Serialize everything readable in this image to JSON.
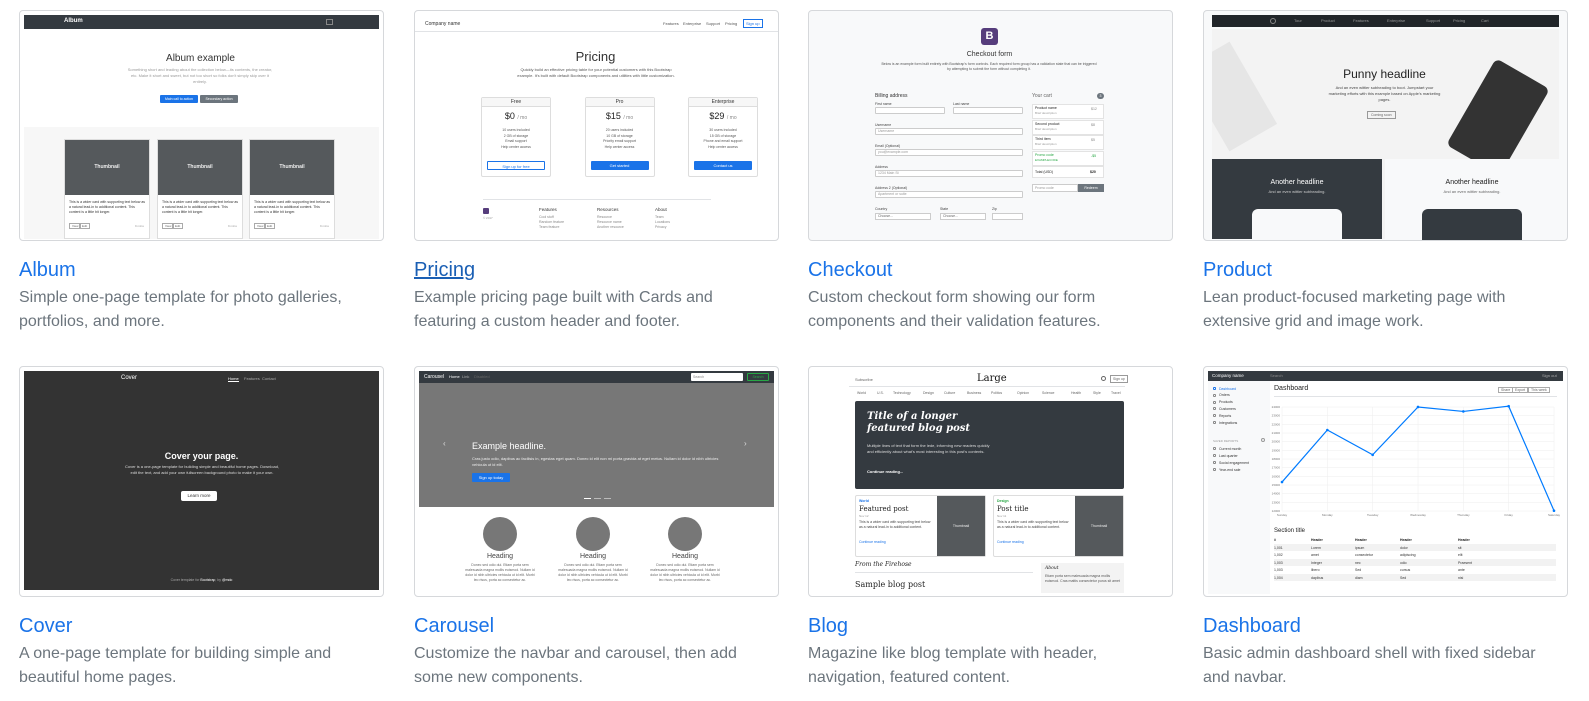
{
  "templates": [
    {
      "title": "Album",
      "desc": "Simple one-page template for photo galleries, portfolios, and more.",
      "preview": {
        "brand": "Album",
        "heading": "Album example",
        "sub": "Something short and leading about the collection below—its contents, the creator, etc. Make it short and sweet, but not too short so folks don't simply skip over it entirely.",
        "btn1": "Main call to action",
        "btn2": "Secondary action",
        "card_label": "Thumbnail",
        "card_text": "This is a wider card with supporting text below as a natural lead-in to additional content. This content is a little bit longer.",
        "view": "View",
        "edit": "Edit",
        "mins": "9 mins"
      }
    },
    {
      "title": "Pricing",
      "desc": "Example pricing page built with Cards and featuring a custom header and footer.",
      "preview": {
        "company": "Company name",
        "nav": [
          "Features",
          "Enterprise",
          "Support",
          "Pricing"
        ],
        "signup": "Sign up",
        "heading": "Pricing",
        "sub": "Quickly build an effective pricing table for your potential customers with this Bootstrap example. It's built with default Bootstrap components and utilities with little customization.",
        "plans": [
          {
            "name": "Free",
            "price": "$0",
            "per": "/ mo",
            "feats": [
              "10 users included",
              "2 GB of storage",
              "Email support",
              "Help center access"
            ],
            "btn": "Sign up for free"
          },
          {
            "name": "Pro",
            "price": "$15",
            "per": "/ mo",
            "feats": [
              "20 users included",
              "10 GB of storage",
              "Priority email support",
              "Help center access"
            ],
            "btn": "Get started"
          },
          {
            "name": "Enterprise",
            "price": "$29",
            "per": "/ mo",
            "feats": [
              "30 users included",
              "15 GB of storage",
              "Phone and email support",
              "Help center access"
            ],
            "btn": "Contact us"
          }
        ],
        "footer": [
          {
            "h": "Features",
            "items": [
              "Cool stuff",
              "Random feature",
              "Team feature"
            ]
          },
          {
            "h": "Resources",
            "items": [
              "Resource",
              "Resource name",
              "Another resource"
            ]
          },
          {
            "h": "About",
            "items": [
              "Team",
              "Locations",
              "Privacy"
            ]
          }
        ],
        "year": "© 2017"
      }
    },
    {
      "title": "Checkout",
      "desc": "Custom checkout form showing our form components and their validation features.",
      "preview": {
        "logo": "B",
        "heading": "Checkout form",
        "sub": "Below is an example form built entirely with Bootstrap's form controls. Each required form group has a validation state that can be triggered by attempting to submit the form without completing it.",
        "billing": "Billing address",
        "first": "First name",
        "last": "Last name",
        "username": "Username",
        "username_ph": "Username",
        "email": "Email (Optional)",
        "email_ph": "you@example.com",
        "address": "Address",
        "address_ph": "1234 Main St",
        "address2": "Address 2 (Optional)",
        "address2_ph": "Apartment or suite",
        "country": "Country",
        "state": "State",
        "zip": "Zip",
        "choose": "Choose...",
        "cart": "Your cart",
        "cart_count": "3",
        "items": [
          {
            "name": "Product name",
            "sub": "Brief description",
            "price": "$12"
          },
          {
            "name": "Second product",
            "sub": "Brief description",
            "price": "$8"
          },
          {
            "name": "Third item",
            "sub": "Brief description",
            "price": "$5"
          },
          {
            "name": "Promo code",
            "sub": "EXAMPLECODE",
            "price": "-$5"
          }
        ],
        "total_label": "Total (USD)",
        "total": "$20",
        "promo_ph": "Promo code",
        "redeem": "Redeem"
      }
    },
    {
      "title": "Product",
      "desc": "Lean product-focused marketing page with extensive grid and image work.",
      "preview": {
        "nav": [
          "Tour",
          "Product",
          "Features",
          "Enterprise",
          "Support",
          "Pricing",
          "Cart"
        ],
        "heading": "Punny headline",
        "sub": "And an even wittier subheading to boot. Jumpstart your marketing efforts with this example based on Apple's marketing pages.",
        "btn": "Coming soon",
        "h2a": "Another headline",
        "s2a": "And an even wittier subheading.",
        "h2b": "Another headline",
        "s2b": "And an even wittier subheading."
      }
    },
    {
      "title": "Cover",
      "desc": "A one-page template for building simple and beautiful home pages.",
      "preview": {
        "brand": "Cover",
        "nav": [
          "Home",
          "Features",
          "Contact"
        ],
        "heading": "Cover your page.",
        "sub": "Cover is a one-page template for building simple and beautiful home pages. Download, edit the text, and add your own fullscreen background photo to make it your own.",
        "btn": "Learn more",
        "footer_pre": "Cover template for",
        "footer_link1": "Bootstrap",
        "footer_mid": ", by",
        "footer_link2": "@mdo"
      }
    },
    {
      "title": "Carousel",
      "desc": "Customize the navbar and carousel, then add some new components.",
      "preview": {
        "brand": "Carousel",
        "nav": [
          "Home",
          "Link",
          "Disabled"
        ],
        "search_ph": "Search",
        "search_btn": "Search",
        "heading": "Example headline.",
        "sub": "Cras justo odio, dapibus ac facilisis in, egestas eget quam. Donec id elit non mi porta gravida at eget metus. Nullam id dolor id nibh ultricies vehicula ut id elit.",
        "btn": "Sign up today",
        "col_heading": "Heading",
        "col_text": "Donec sed odio dui. Etiam porta sem malesuada magna mollis euismod. Nullam id dolor id nibh ultricies vehicula ut id elit. Morbi leo risus, porta ac consectetur ac."
      }
    },
    {
      "title": "Blog",
      "desc": "Magazine like blog template with header, navigation, featured content.",
      "preview": {
        "subscribe": "Subscribe",
        "logo": "Large",
        "signup": "Sign up",
        "nav": [
          "World",
          "U.S.",
          "Technology",
          "Design",
          "Culture",
          "Business",
          "Politics",
          "Opinion",
          "Science",
          "Health",
          "Style",
          "Travel"
        ],
        "hero_title": "Title of a longer featured blog post",
        "hero_sub": "Multiple lines of text that form the lede, informing new readers quickly and efficiently about what's most interesting in this post's contents.",
        "hero_link": "Continue reading...",
        "cards": [
          {
            "cat": "World",
            "title": "Featured post",
            "date": "Nov 12",
            "text": "This is a wider card with supporting text below as a natural lead-in to additional content.",
            "link": "Continue reading",
            "thumb": "Thumbnail"
          },
          {
            "cat": "Design",
            "title": "Post title",
            "date": "Nov 11",
            "text": "This is a wider card with supporting text below as a natural lead-in to additional content.",
            "link": "Continue reading",
            "thumb": "Thumbnail"
          }
        ],
        "from": "From the Firehose",
        "post": "Sample blog post",
        "about": "About",
        "about_text": "Etiam porta sem malesuada magna mollis euismod. Cras mattis consectetur purus sit amet fermentum."
      }
    },
    {
      "title": "Dashboard",
      "desc": "Basic admin dashboard shell with fixed sidebar and navbar.",
      "preview": {
        "company": "Company name",
        "search_ph": "Search",
        "signout": "Sign out",
        "side": [
          "Dashboard",
          "Orders",
          "Products",
          "Customers",
          "Reports",
          "Integrations"
        ],
        "saved": "SAVED REPORTS",
        "saved_items": [
          "Current month",
          "Last quarter",
          "Social engagement",
          "Year-end sale"
        ],
        "heading": "Dashboard",
        "share": "Share",
        "export": "Export",
        "week": "This week",
        "section": "Section title",
        "table_head": [
          "#",
          "Header",
          "Header",
          "Header",
          "Header"
        ],
        "table_rows": [
          [
            "1,001",
            "Lorem",
            "ipsum",
            "dolor",
            "sit"
          ],
          [
            "1,002",
            "amet",
            "consectetur",
            "adipiscing",
            "elit"
          ],
          [
            "1,003",
            "Integer",
            "nec",
            "odio",
            "Praesent"
          ],
          [
            "1,003",
            "libero",
            "Sed",
            "cursus",
            "ante"
          ],
          [
            "1,004",
            "dapibus",
            "diam",
            "Sed",
            "nisi"
          ]
        ]
      }
    }
  ],
  "chart_data": {
    "type": "line",
    "categories": [
      "Sunday",
      "Monday",
      "Tuesday",
      "Wednesday",
      "Thursday",
      "Friday",
      "Saturday"
    ],
    "values": [
      15339,
      21345,
      18483,
      24003,
      23489,
      24092,
      12034
    ],
    "ylim": [
      12000,
      24000
    ],
    "color": "#007bff",
    "yticks": [
      "24000",
      "23000",
      "22000",
      "21000",
      "20000",
      "19000",
      "18000",
      "17000",
      "16000",
      "15000",
      "14000",
      "13000",
      "12000"
    ]
  },
  "colors": {
    "link": "#1a73e8",
    "muted": "#6c757d",
    "dark": "#343a40",
    "purple": "#563d7c"
  }
}
